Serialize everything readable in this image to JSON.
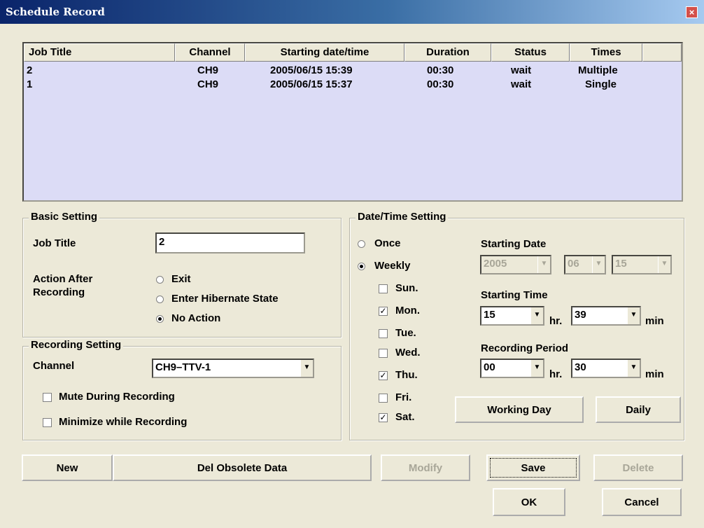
{
  "window": {
    "title": "Schedule Record",
    "close_glyph": "×"
  },
  "list": {
    "headers": [
      "Job Title",
      "Channel",
      "Starting date/time",
      "Duration",
      "Status",
      "Times"
    ],
    "rows": [
      {
        "job": "2",
        "channel": "CH9",
        "start": "2005/06/15 15:39",
        "duration": "00:30",
        "status": "wait",
        "times": "Multiple"
      },
      {
        "job": "1",
        "channel": "CH9",
        "start": "2005/06/15 15:37",
        "duration": "00:30",
        "status": "wait",
        "times": "Single"
      }
    ]
  },
  "basic": {
    "title": "Basic Setting",
    "job_title_label": "Job Title",
    "job_title_value": "2",
    "action_label_1": "Action After",
    "action_label_2": "Recording",
    "actions": [
      {
        "label": "Exit",
        "selected": false
      },
      {
        "label": "Enter Hibernate State",
        "selected": false
      },
      {
        "label": "No Action",
        "selected": true
      }
    ]
  },
  "recording": {
    "title": "Recording Setting",
    "channel_label": "Channel",
    "channel_value": "CH9–TTV-1",
    "mute_label": "Mute During Recording",
    "mute_checked": false,
    "minimize_label": "Minimize while Recording",
    "minimize_checked": false
  },
  "datetime": {
    "title": "Date/Time Setting",
    "once_label": "Once",
    "weekly_label": "Weekly",
    "mode": "weekly",
    "days": [
      {
        "label": "Sun.",
        "checked": false
      },
      {
        "label": "Mon.",
        "checked": true
      },
      {
        "label": "Tue.",
        "checked": false
      },
      {
        "label": "Wed.",
        "checked": false
      },
      {
        "label": "Thu.",
        "checked": true
      },
      {
        "label": "Fri.",
        "checked": false
      },
      {
        "label": "Sat.",
        "checked": true
      }
    ],
    "starting_date_label": "Starting Date",
    "date_year": "2005",
    "date_month": "06",
    "date_day": "15",
    "starting_time_label": "Starting Time",
    "time_hr": "15",
    "time_min": "39",
    "hr_label": "hr.",
    "min_label": "min",
    "period_label": "Recording Period",
    "period_hr": "00",
    "period_min": "30",
    "working_day_label": "Working Day",
    "daily_label": "Daily"
  },
  "buttons": {
    "new": "New",
    "del_obsolete": "Del Obsolete Data",
    "modify": "Modify",
    "save": "Save",
    "delete": "Delete",
    "ok": "OK",
    "cancel": "Cancel"
  },
  "icons": {
    "check_glyph": "✓",
    "dropdown_glyph": "▼"
  }
}
